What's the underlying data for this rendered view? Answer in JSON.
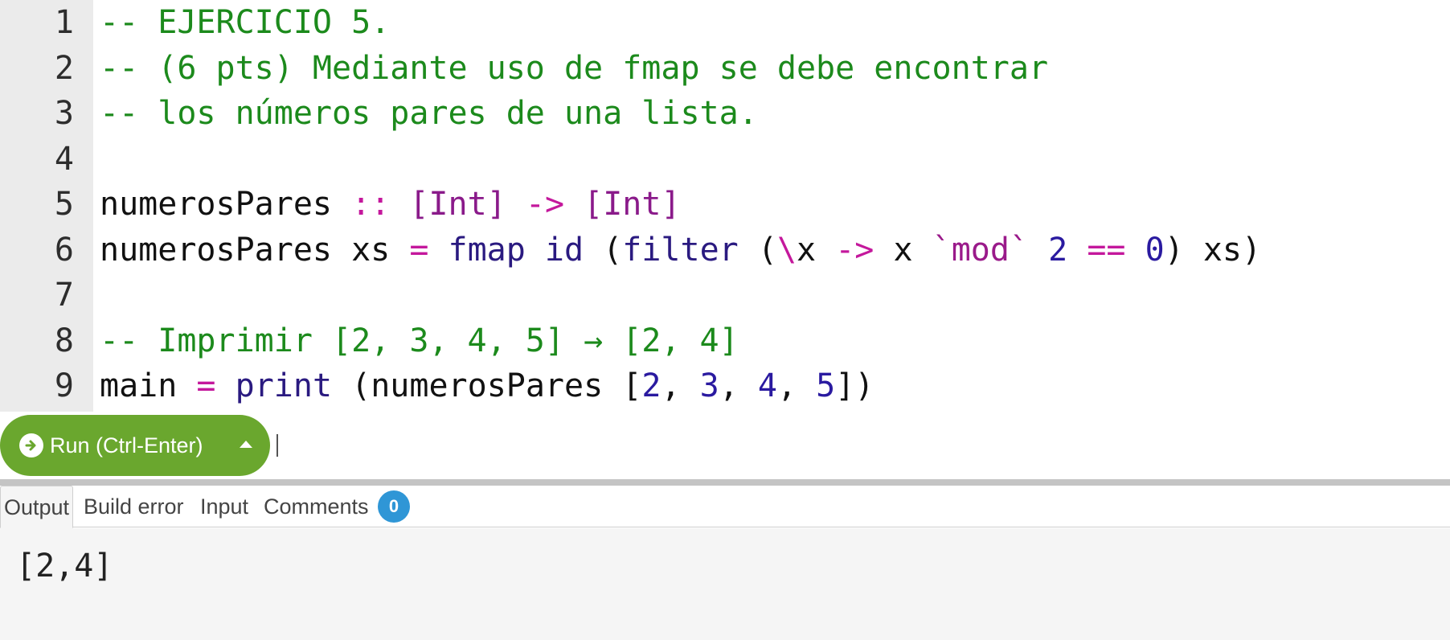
{
  "editor": {
    "lines": [
      {
        "n": "1",
        "tokens": [
          {
            "t": "comment",
            "v": "-- EJERCICIO 5."
          }
        ]
      },
      {
        "n": "2",
        "tokens": [
          {
            "t": "comment",
            "v": "-- (6 pts) Mediante uso de fmap se debe encontrar"
          }
        ]
      },
      {
        "n": "3",
        "tokens": [
          {
            "t": "comment",
            "v": "-- los números pares de una lista."
          }
        ]
      },
      {
        "n": "4",
        "tokens": []
      },
      {
        "n": "5",
        "tokens": [
          {
            "t": "plain",
            "v": "numerosPares "
          },
          {
            "t": "punct",
            "v": "::"
          },
          {
            "t": "plain",
            "v": " "
          },
          {
            "t": "type",
            "v": "[Int]"
          },
          {
            "t": "plain",
            "v": " "
          },
          {
            "t": "punct",
            "v": "->"
          },
          {
            "t": "plain",
            "v": " "
          },
          {
            "t": "type",
            "v": "[Int]"
          }
        ]
      },
      {
        "n": "6",
        "tokens": [
          {
            "t": "plain",
            "v": "numerosPares xs "
          },
          {
            "t": "punct",
            "v": "="
          },
          {
            "t": "plain",
            "v": " "
          },
          {
            "t": "kw",
            "v": "fmap"
          },
          {
            "t": "plain",
            "v": " "
          },
          {
            "t": "kw",
            "v": "id"
          },
          {
            "t": "plain",
            "v": " ("
          },
          {
            "t": "kw",
            "v": "filter"
          },
          {
            "t": "plain",
            "v": " ("
          },
          {
            "t": "punct",
            "v": "\\"
          },
          {
            "t": "plain",
            "v": "x "
          },
          {
            "t": "punct",
            "v": "->"
          },
          {
            "t": "plain",
            "v": " x "
          },
          {
            "t": "str",
            "v": "`mod`"
          },
          {
            "t": "plain",
            "v": " "
          },
          {
            "t": "num",
            "v": "2"
          },
          {
            "t": "plain",
            "v": " "
          },
          {
            "t": "punct",
            "v": "=="
          },
          {
            "t": "plain",
            "v": " "
          },
          {
            "t": "num",
            "v": "0"
          },
          {
            "t": "plain",
            "v": ") xs)"
          }
        ]
      },
      {
        "n": "7",
        "tokens": []
      },
      {
        "n": "8",
        "tokens": [
          {
            "t": "comment",
            "v": "-- Imprimir [2, 3, 4, 5] → [2, 4]"
          }
        ]
      },
      {
        "n": "9",
        "tokens": [
          {
            "t": "plain",
            "v": "main "
          },
          {
            "t": "punct",
            "v": "="
          },
          {
            "t": "plain",
            "v": " "
          },
          {
            "t": "kw",
            "v": "print"
          },
          {
            "t": "plain",
            "v": " (numerosPares ["
          },
          {
            "t": "num",
            "v": "2"
          },
          {
            "t": "plain",
            "v": ", "
          },
          {
            "t": "num",
            "v": "3"
          },
          {
            "t": "plain",
            "v": ", "
          },
          {
            "t": "num",
            "v": "4"
          },
          {
            "t": "plain",
            "v": ", "
          },
          {
            "t": "num",
            "v": "5"
          },
          {
            "t": "plain",
            "v": "])"
          }
        ]
      }
    ]
  },
  "runbar": {
    "run_label": "Run (Ctrl-Enter)",
    "run_icon": "arrow-circle-right-icon",
    "menu_icon": "caret-up-icon",
    "accent_color": "#6aa72e"
  },
  "panel": {
    "tabs": [
      {
        "id": "output",
        "label": "Output",
        "active": true
      },
      {
        "id": "build-error",
        "label": "Build error",
        "active": false
      },
      {
        "id": "input",
        "label": "Input",
        "active": false
      },
      {
        "id": "comments",
        "label": "Comments",
        "active": false,
        "badge": "0"
      }
    ],
    "badge_color": "#2f96d6",
    "output_text": "[2,4]"
  }
}
